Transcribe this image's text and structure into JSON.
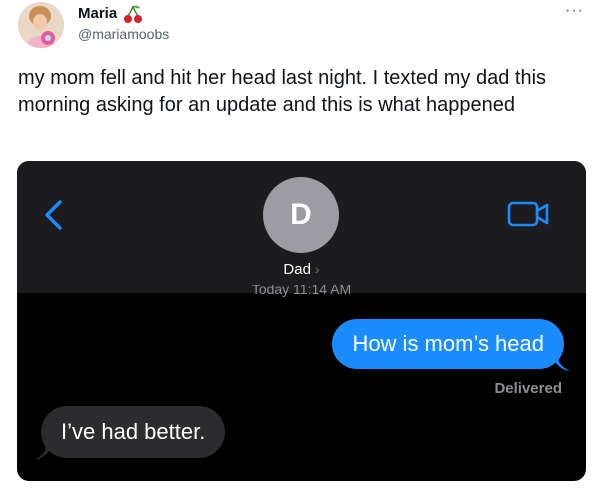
{
  "tweet": {
    "author_name": "Maria",
    "author_emoji": "cherries-emoji",
    "author_handle": "@mariamoobs",
    "more_label": "···",
    "text": "my mom fell and hit her head last night. I texted my dad this morning asking for an update and this is what happened"
  },
  "screenshot": {
    "back_icon": "chevron-left-icon",
    "contact_initial": "D",
    "contact_name": "Dad",
    "contact_chevron": "›",
    "video_icon": "video-camera-icon",
    "timestamp": "Today 11:14 AM",
    "messages": [
      {
        "direction": "outgoing",
        "text": "How is mom’s head"
      },
      {
        "direction": "incoming",
        "text": "I’ve had better."
      }
    ],
    "delivered_label": "Delivered"
  },
  "colors": {
    "ios_blue": "#1a8cff",
    "incoming_bubble": "#2c2c2e",
    "header_bg": "#1c1c1e"
  }
}
